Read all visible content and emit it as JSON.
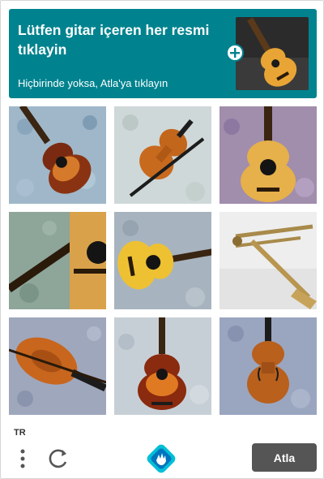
{
  "prompt": {
    "title": "Lütfen gitar içeren her resmi tıklayin",
    "subtitle": "Hiçbirinde yoksa, Atla'ya tıklayın",
    "background_color": "#00838f"
  },
  "grid": {
    "tiles": [
      {
        "subject": "acoustic-guitar-sunburst"
      },
      {
        "subject": "violin-with-bow"
      },
      {
        "subject": "acoustic-guitar-natural"
      },
      {
        "subject": "acoustic-guitar-closeup"
      },
      {
        "subject": "acoustic-guitar-yellow"
      },
      {
        "subject": "trombone"
      },
      {
        "subject": "violin-closeup"
      },
      {
        "subject": "acoustic-guitar-sunburst-standing"
      },
      {
        "subject": "violin-standing"
      }
    ]
  },
  "footer": {
    "language": "TR",
    "skip_label": "Atla",
    "skip_color": "#555555",
    "icons": [
      "menu-icon",
      "refresh-icon",
      "hcaptcha-logo-icon"
    ]
  }
}
